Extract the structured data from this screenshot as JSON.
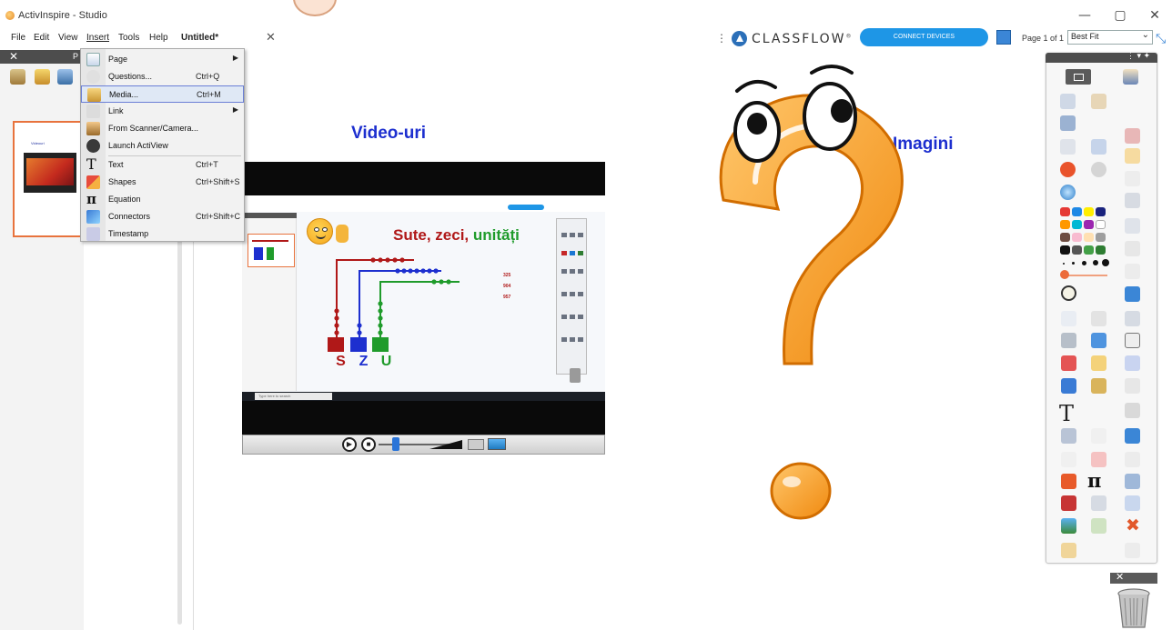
{
  "window": {
    "title": "ActivInspire - Studio",
    "minimize": "—",
    "maximize": "▢",
    "close": "✕"
  },
  "menubar": {
    "items": [
      "File",
      "Edit",
      "View",
      "Insert",
      "Tools",
      "Help"
    ],
    "document_tab": "Untitled*",
    "tab_close": "✕"
  },
  "classflow": {
    "dots": "⋮",
    "brand": "CLASSFLOW",
    "trademark": "®",
    "connect_label": "CONNECT DEVICES",
    "page_indicator": "Page 1 of 1",
    "zoom_value": "Best Fit",
    "chevron": "⌄",
    "fullscreen_glyph": "⤡"
  },
  "left_panel": {
    "close": "✕",
    "label": "P",
    "thumb_title": "Videouri"
  },
  "insert_menu": {
    "items": [
      {
        "label": "Page",
        "shortcut": "",
        "submenu": true,
        "icon": "page-icon"
      },
      {
        "label": "Questions...",
        "shortcut": "Ctrl+Q",
        "submenu": false,
        "icon": "questions-icon"
      },
      {
        "label": "Media...",
        "shortcut": "Ctrl+M",
        "submenu": false,
        "icon": "media-icon"
      },
      {
        "label": "Link",
        "shortcut": "",
        "submenu": true,
        "icon": "link-icon"
      },
      {
        "label": "From Scanner/Camera...",
        "shortcut": "",
        "submenu": false,
        "icon": "scanner-icon"
      },
      {
        "label": "Launch ActiView",
        "shortcut": "",
        "submenu": false,
        "icon": "actiview-icon"
      },
      {
        "label": "Text",
        "shortcut": "Ctrl+T",
        "submenu": false,
        "icon": "text-icon"
      },
      {
        "label": "Shapes",
        "shortcut": "Ctrl+Shift+S",
        "submenu": false,
        "icon": "shapes-icon"
      },
      {
        "label": "Equation",
        "shortcut": "",
        "submenu": false,
        "icon": "equation-icon"
      },
      {
        "label": "Connectors",
        "shortcut": "Ctrl+Shift+C",
        "submenu": false,
        "icon": "connectors-icon"
      },
      {
        "label": "Timestamp",
        "shortcut": "",
        "submenu": false,
        "icon": "timestamp-icon"
      }
    ],
    "submenu_arrow": "▶",
    "active_index": 2
  },
  "canvas": {
    "video_label": "Video-uri",
    "images_label": "Imagini",
    "video": {
      "heading_part1": "Sute, zeci, ",
      "heading_part2": "unități",
      "numbers": [
        "325",
        "904",
        "957"
      ],
      "letters": [
        "S",
        "Z",
        "U"
      ],
      "search_placeholder": "Type here to search",
      "play_glyph": "▶",
      "stop_glyph": "■"
    },
    "colors": {
      "red": "#b01818",
      "blue": "#1d2fcf",
      "green": "#1f9b2b",
      "orange": "#f59a2a"
    }
  },
  "toolbox": {
    "header_dots": "⋮ ▾ ✦",
    "text_glyph": "T",
    "pi_glyph": "π",
    "delete_glyph": "✖"
  },
  "trash": {
    "close": "✕"
  }
}
